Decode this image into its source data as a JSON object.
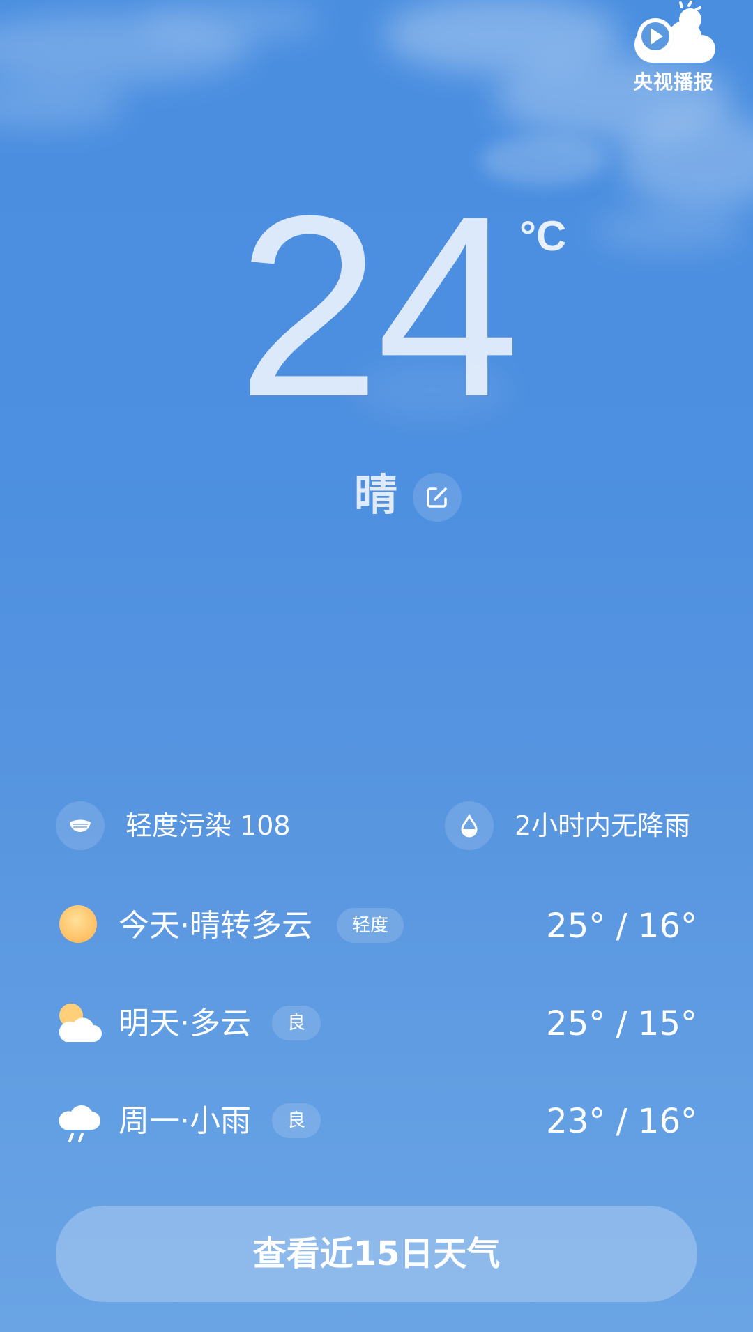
{
  "header": {
    "broadcast_label": "央视播报"
  },
  "current": {
    "temperature": "24",
    "unit": "°C",
    "condition": "晴"
  },
  "info": {
    "aqi_text": "轻度污染 108",
    "rain_text": "2小时内无降雨"
  },
  "forecast": [
    {
      "label": "今天·晴转多云",
      "quality": "轻度",
      "temps": "25° / 16°",
      "icon": "sun-icon"
    },
    {
      "label": "明天·多云",
      "quality": "良",
      "temps": "25° / 15°",
      "icon": "partly-cloudy-icon"
    },
    {
      "label": "周一·小雨",
      "quality": "良",
      "temps": "23° / 16°",
      "icon": "light-rain-icon"
    }
  ],
  "cta": {
    "label": "查看近15日天气"
  },
  "colors": {
    "sky_top": "#4a8ee0",
    "sky_bottom": "#6aa4e5",
    "sun": "#ffc870"
  }
}
